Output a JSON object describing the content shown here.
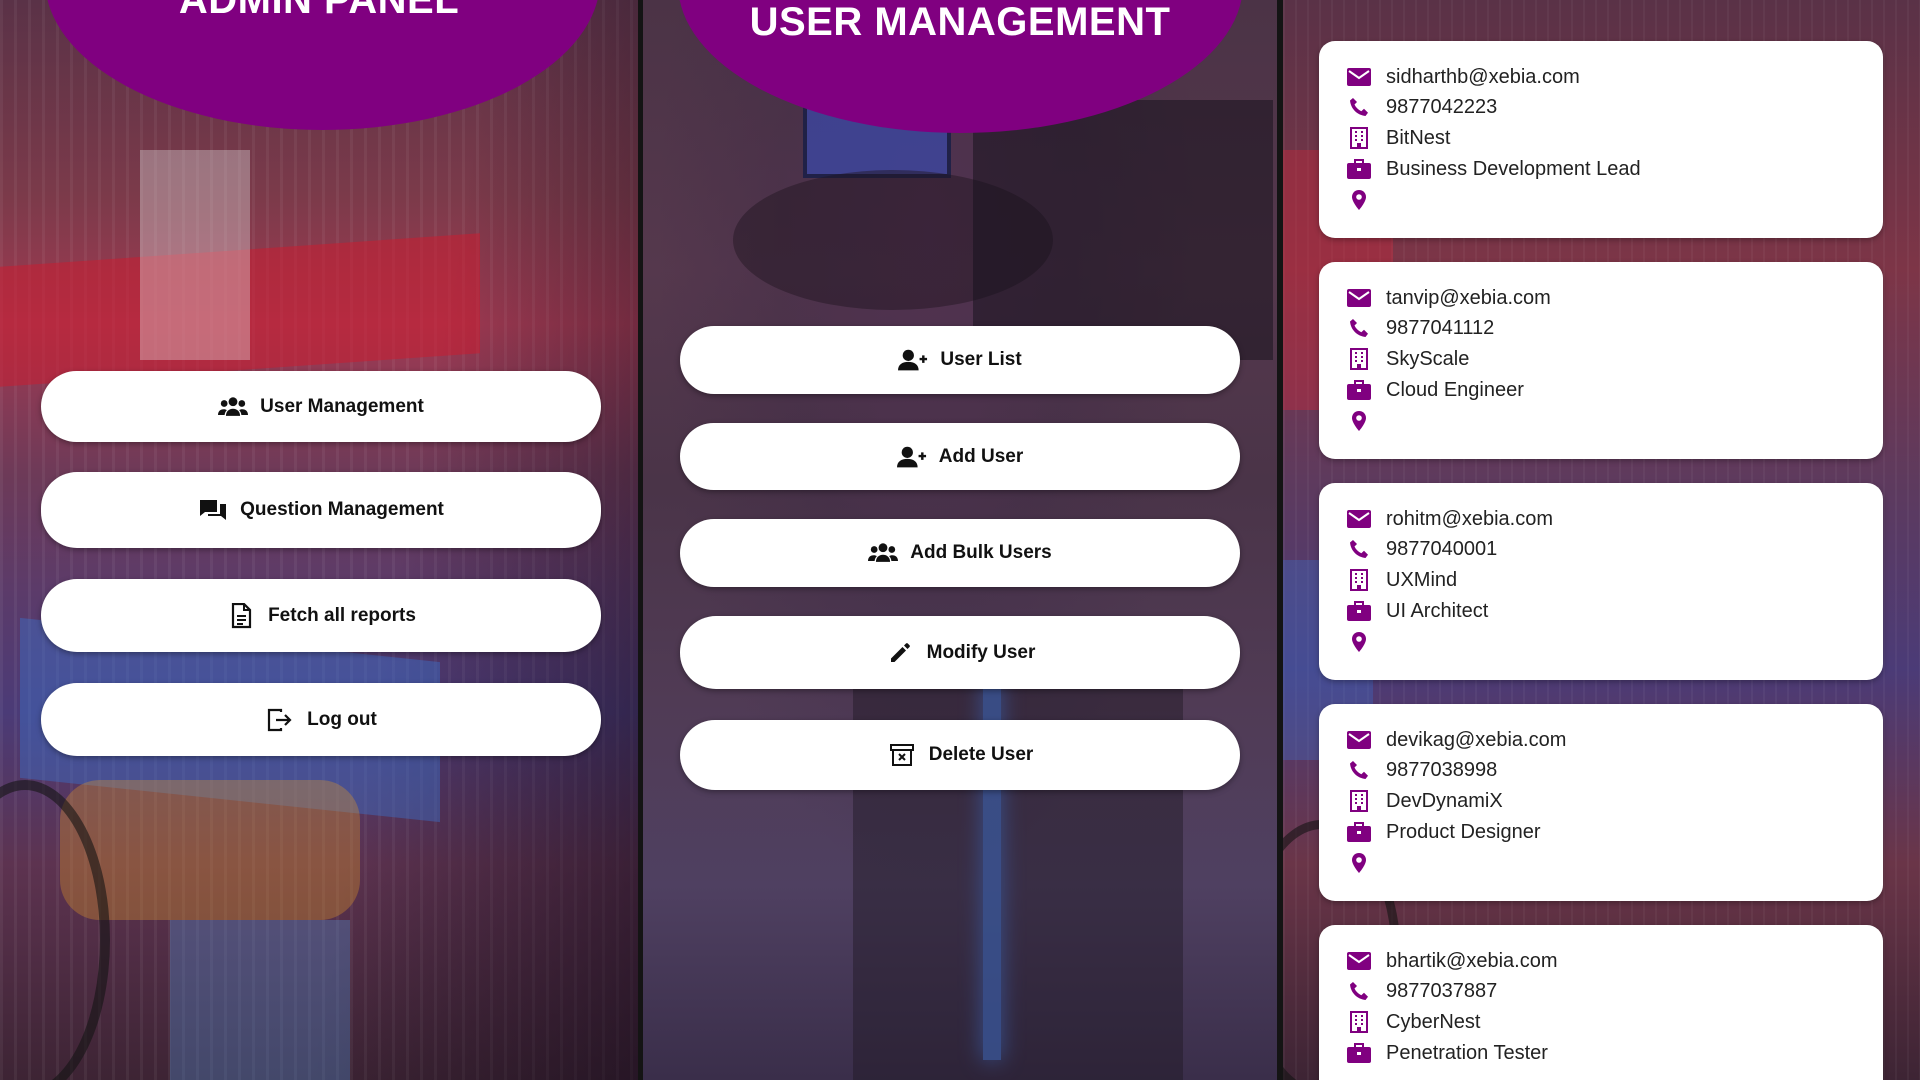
{
  "admin_panel": {
    "title": "ADMIN PANEL",
    "menu": [
      {
        "label": "User Management",
        "icon": "users-icon"
      },
      {
        "label": "Question Management",
        "icon": "chat-icon"
      },
      {
        "label": "Fetch all reports",
        "icon": "document-icon"
      },
      {
        "label": "Log out",
        "icon": "logout-icon"
      }
    ]
  },
  "user_management": {
    "title": "USER MANAGEMENT",
    "menu": [
      {
        "label": "User List",
        "icon": "user-plus-icon"
      },
      {
        "label": "Add User",
        "icon": "user-plus-icon"
      },
      {
        "label": "Add Bulk Users",
        "icon": "users-icon"
      },
      {
        "label": "Modify User",
        "icon": "pencil-icon"
      },
      {
        "label": "Delete User",
        "icon": "delete-box-icon"
      }
    ]
  },
  "user_list": {
    "users": [
      {
        "email": "sidharthb@xebia.com",
        "phone": "9877042223",
        "company": "BitNest",
        "role": "Business Development Lead",
        "location": ""
      },
      {
        "email": "tanvip@xebia.com",
        "phone": "9877041112",
        "company": "SkyScale",
        "role": "Cloud Engineer",
        "location": ""
      },
      {
        "email": "rohitm@xebia.com",
        "phone": "9877040001",
        "company": "UXMind",
        "role": "UI Architect",
        "location": ""
      },
      {
        "email": "devikag@xebia.com",
        "phone": "9877038998",
        "company": "DevDynamiX",
        "role": "Product Designer",
        "location": ""
      },
      {
        "email": "bhartik@xebia.com",
        "phone": "9877037887",
        "company": "CyberNest",
        "role": "Penetration Tester",
        "location": ""
      }
    ]
  },
  "colors": {
    "accent": "#800080",
    "button_bg": "#ffffff",
    "button_text": "#111111",
    "card_bg": "#ffffff"
  }
}
